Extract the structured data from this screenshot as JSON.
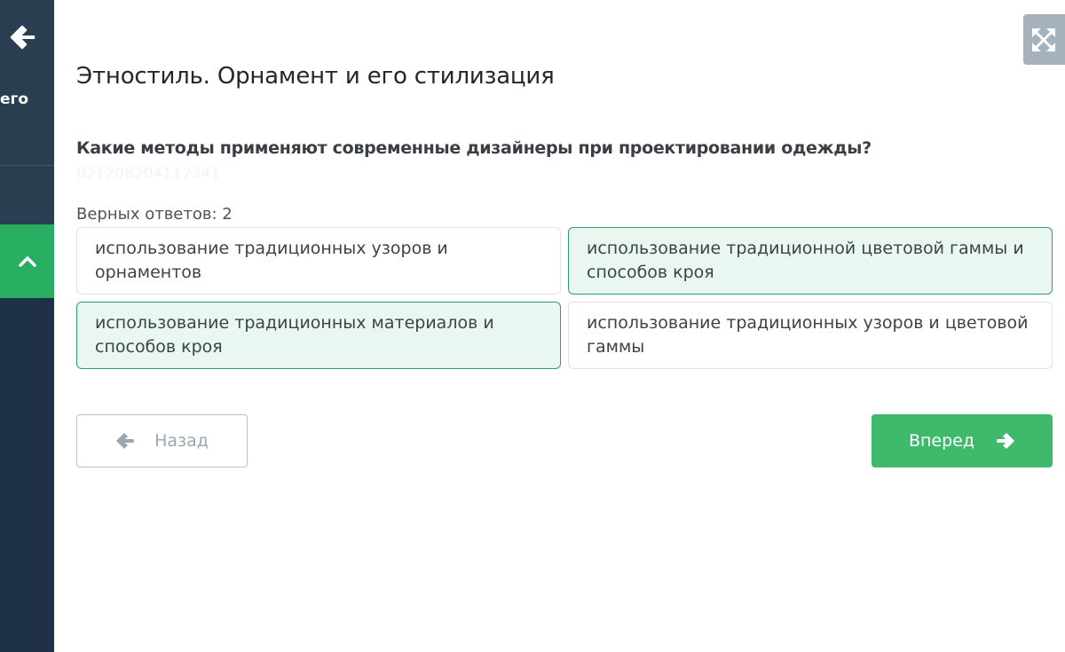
{
  "sidebar": {
    "back_icon": "arrow-left-icon",
    "title_fragment": "его",
    "active_icon": "chevron-up-icon"
  },
  "toolbar": {
    "fullscreen_icon": "expand-icon"
  },
  "lesson": {
    "title": "Этностиль. Орнамент и его стилизация"
  },
  "question": {
    "text": "Какие методы применяют современные дизайнеры при проектировании одежды?",
    "id": "021208204112341",
    "answers_count_label": "Верных ответов: 2"
  },
  "options": [
    {
      "text": "использование традиционных узоров и орнаментов",
      "selected": false
    },
    {
      "text": "использование традиционной цветовой гаммы и способов кроя",
      "selected": true
    },
    {
      "text": "использование традиционных материалов и способов кроя",
      "selected": true
    },
    {
      "text": "использование традиционных узоров и цветовой гаммы",
      "selected": false
    }
  ],
  "nav": {
    "back_label": "Назад",
    "back_icon": "arrow-left-icon",
    "next_label": "Вперед",
    "next_icon": "arrow-right-icon"
  },
  "colors": {
    "sidebar": "#1e3147",
    "accent_green": "#3fb96b",
    "selected_bg": "#eaf7f0",
    "selected_border": "#2e9e6b"
  }
}
